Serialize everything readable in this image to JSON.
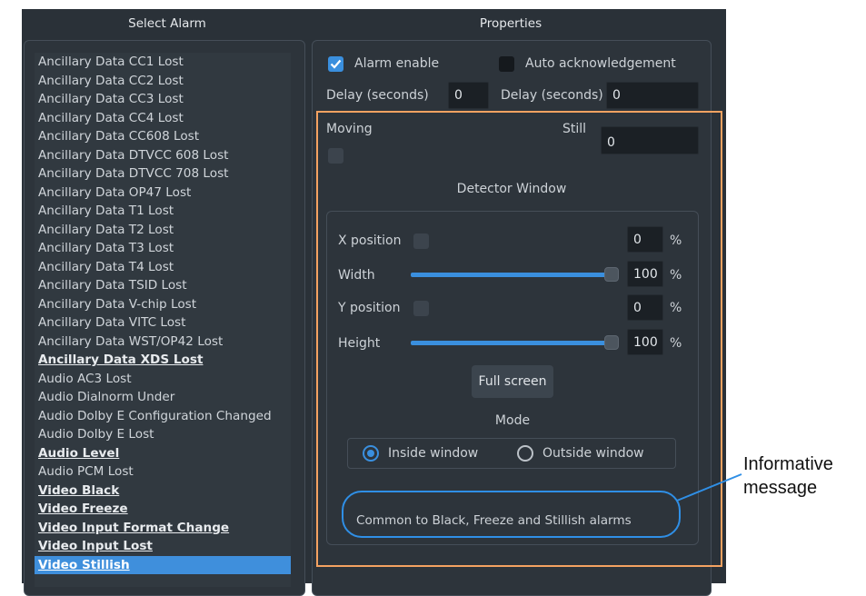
{
  "left_title": "Select Alarm",
  "right_title": "Properties",
  "alarms": [
    {
      "label": "Ancillary Data CC1 Lost",
      "bold": false,
      "selected": false
    },
    {
      "label": "Ancillary Data CC2 Lost",
      "bold": false,
      "selected": false
    },
    {
      "label": "Ancillary Data CC3 Lost",
      "bold": false,
      "selected": false
    },
    {
      "label": "Ancillary Data CC4 Lost",
      "bold": false,
      "selected": false
    },
    {
      "label": "Ancillary Data CC608 Lost",
      "bold": false,
      "selected": false
    },
    {
      "label": "Ancillary Data DTVCC 608 Lost",
      "bold": false,
      "selected": false
    },
    {
      "label": "Ancillary Data DTVCC 708 Lost",
      "bold": false,
      "selected": false
    },
    {
      "label": "Ancillary Data OP47 Lost",
      "bold": false,
      "selected": false
    },
    {
      "label": "Ancillary Data T1 Lost",
      "bold": false,
      "selected": false
    },
    {
      "label": "Ancillary Data T2 Lost",
      "bold": false,
      "selected": false
    },
    {
      "label": "Ancillary Data T3 Lost",
      "bold": false,
      "selected": false
    },
    {
      "label": "Ancillary Data T4 Lost",
      "bold": false,
      "selected": false
    },
    {
      "label": "Ancillary Data TSID Lost",
      "bold": false,
      "selected": false
    },
    {
      "label": "Ancillary Data V-chip Lost",
      "bold": false,
      "selected": false
    },
    {
      "label": "Ancillary Data VITC Lost",
      "bold": false,
      "selected": false
    },
    {
      "label": "Ancillary Data WST/OP42 Lost",
      "bold": false,
      "selected": false
    },
    {
      "label": "Ancillary Data XDS Lost",
      "bold": true,
      "selected": false
    },
    {
      "label": "Audio AC3 Lost",
      "bold": false,
      "selected": false
    },
    {
      "label": "Audio Dialnorm Under",
      "bold": false,
      "selected": false
    },
    {
      "label": "Audio Dolby E Configuration Changed",
      "bold": false,
      "selected": false
    },
    {
      "label": "Audio Dolby E Lost",
      "bold": false,
      "selected": false
    },
    {
      "label": "Audio Level",
      "bold": true,
      "selected": false
    },
    {
      "label": "Audio PCM Lost",
      "bold": false,
      "selected": false
    },
    {
      "label": "Video Black",
      "bold": true,
      "selected": false
    },
    {
      "label": "Video Freeze",
      "bold": true,
      "selected": false
    },
    {
      "label": "Video Input Format Change",
      "bold": true,
      "selected": false
    },
    {
      "label": "Video Input Lost",
      "bold": true,
      "selected": false
    },
    {
      "label": "Video Stillish",
      "bold": true,
      "selected": true
    }
  ],
  "props": {
    "alarm_enable_label": "Alarm enable",
    "alarm_enable_checked": true,
    "auto_ack_label": "Auto acknowledgement",
    "auto_ack_checked": false,
    "delay_label_1": "Delay (seconds)",
    "delay_value_1": "0",
    "delay_label_2": "Delay (seconds)",
    "delay_value_2": "0",
    "moving_label": "Moving",
    "still_label": "Still",
    "still_value": "0",
    "detector_title": "Detector Window",
    "x_position_label": "X position",
    "x_value": "0",
    "width_label": "Width",
    "width_value": "100",
    "y_position_label": "Y position",
    "y_value": "0",
    "height_label": "Height",
    "height_value": "100",
    "percent": "%",
    "full_screen_label": "Full screen",
    "mode_title": "Mode",
    "inside_window_label": "Inside window",
    "outside_window_label": "Outside window",
    "message": "Common to Black, Freeze and Stillish alarms"
  },
  "annotation": "Informative message",
  "colors": {
    "accent": "#3a8fde",
    "highlight_box": "#f4a261",
    "callout": "#2f8fe6"
  }
}
